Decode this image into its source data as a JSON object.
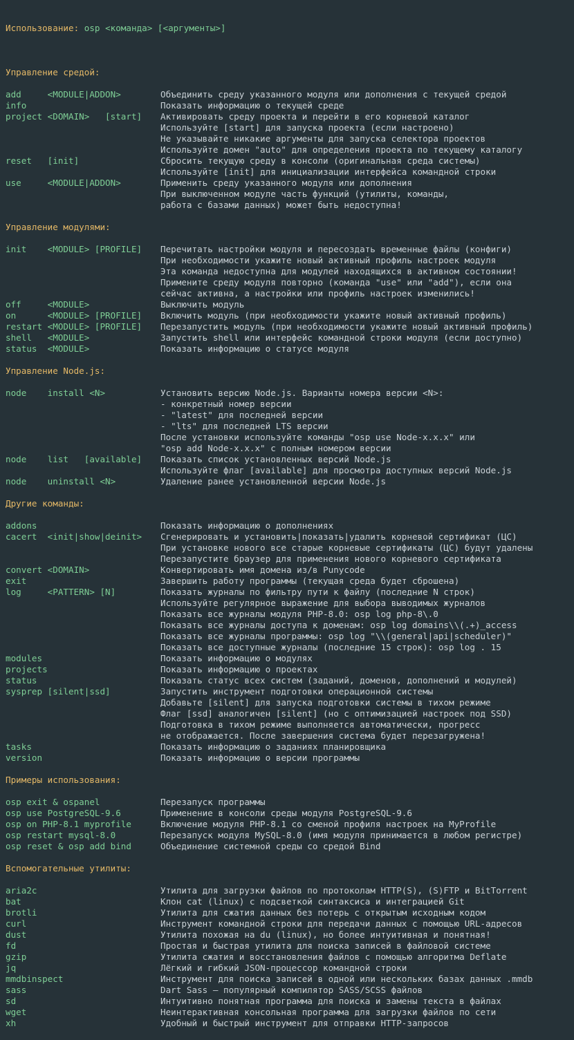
{
  "usage": {
    "label": "Использование:",
    "command": "osp <команда> [<аргументы>]"
  },
  "colors": {
    "background": "#263238",
    "heading": "#e5b967",
    "command": "#7fcf96",
    "text": "#c9d1d6"
  },
  "sections": [
    {
      "title": "Управление средой:",
      "items": [
        {
          "cmd": "add     <MODULE|ADDON>",
          "desc": [
            "Объединить среду указанного модуля или дополнения с текущей средой"
          ]
        },
        {
          "cmd": "info",
          "desc": [
            "Показать информацию о текущей среде"
          ]
        },
        {
          "cmd": "project <DOMAIN>   [start]",
          "desc": [
            "Активировать среду проекта и перейти в его корневой каталог",
            "Используйте [start] для запуска проекта (если настроено)",
            "Не указывайте никакие аргументы для запуска селектора проектов",
            "Используйте домен \"auto\" для определения проекта по текущему каталогу"
          ]
        },
        {
          "cmd": "reset   [init]",
          "desc": [
            "Сбросить текущую среду в консоли (оригинальная среда системы)",
            "Используйте [init] для инициализации интерфейса командной строки"
          ]
        },
        {
          "cmd": "use     <MODULE|ADDON>",
          "desc": [
            "Применить среду указанного модуля или дополнения",
            "При выключенном модуле часть функций (утилиты, команды,",
            "работа с базами данных) может быть недоступна!"
          ]
        }
      ]
    },
    {
      "title": "Управление модулями:",
      "items": [
        {
          "cmd": "init    <MODULE> [PROFILE]",
          "desc": [
            "Перечитать настройки модуля и пересоздать временные файлы (конфиги)",
            "При необходимости укажите новый активный профиль настроек модуля",
            "Эта команда недоступна для модулей находящихся в активном состоянии!",
            "Примените среду модуля повторно (команда \"use\" или \"add\"), если она",
            "сейчас активна, а настройки или профиль настроек изменились!"
          ]
        },
        {
          "cmd": "off     <MODULE>",
          "desc": [
            "Выключить модуль"
          ]
        },
        {
          "cmd": "on      <MODULE> [PROFILE]",
          "desc": [
            "Включить модуль (при необходимости укажите новый активный профиль)"
          ]
        },
        {
          "cmd": "restart <MODULE> [PROFILE]",
          "desc": [
            "Перезапустить модуль (при необходимости укажите новый активный профиль)"
          ]
        },
        {
          "cmd": "shell   <MODULE>",
          "desc": [
            "Запустить shell или интерфейс командной строки модуля (если доступно)"
          ]
        },
        {
          "cmd": "status  <MODULE>",
          "desc": [
            "Показать информацию о статусе модуля"
          ]
        }
      ]
    },
    {
      "title": "Управление Node.js:",
      "items": [
        {
          "cmd": "node    install <N>",
          "desc": [
            "Установить версию Node.js. Варианты номера версии <N>:",
            "- конкретный номер версии",
            "- \"latest\" для последней версии",
            "- \"lts\" для последней LTS версии",
            "После установки используйте команды \"osp use Node-x.x.x\" или",
            "\"osp add Node-x.x.x\" с полным номером версии"
          ]
        },
        {
          "cmd": "node    list   [available]",
          "desc": [
            "Показать список установленных версий Node.js",
            "Используйте флаг [available] для просмотра доступных версий Node.js"
          ]
        },
        {
          "cmd": "node    uninstall <N>",
          "desc": [
            "Удаление ранее установленной версии Node.js"
          ]
        }
      ]
    },
    {
      "title": "Другие команды:",
      "items": [
        {
          "cmd": "addons",
          "desc": [
            "Показать информацию о дополнениях"
          ]
        },
        {
          "cmd": "cacert  <init|show|deinit>",
          "desc": [
            "Сгенерировать и установить|показать|удалить корневой сертификат (ЦС)",
            "При установке нового все старые корневые сертификаты (ЦС) будут удалены",
            "Перезапустите браузер для применения нового корневого сертификата"
          ]
        },
        {
          "cmd": "convert <DOMAIN>",
          "desc": [
            "Конвертировать имя домена из/в Punycode"
          ]
        },
        {
          "cmd": "exit",
          "desc": [
            "Завершить работу программы (текущая среда будет сброшена)"
          ]
        },
        {
          "cmd": "log     <PATTERN> [N]",
          "desc": [
            "Показать журналы по фильтру пути к файлу (последние N строк)",
            "Используйте регулярное выражение для выбора выводимых журналов",
            "Показать все журналы модуля PHP-8.0: osp log php-8\\.0",
            "Показать все журналы доступа к доменам: osp log domains\\\\(.+)_access",
            "Показать все журналы программы: osp log \"\\\\(general|api|scheduler)\"",
            "Показать все доступные журналы (последние 15 строк): osp log . 15"
          ]
        },
        {
          "cmd": "modules",
          "desc": [
            "Показать информацию о модулях"
          ]
        },
        {
          "cmd": "projects",
          "desc": [
            "Показать информацию о проектах"
          ]
        },
        {
          "cmd": "status",
          "desc": [
            "Показать статус всех систем (заданий, доменов, дополнений и модулей)"
          ]
        },
        {
          "cmd": "sysprep [silent|ssd]",
          "desc": [
            "Запустить инструмент подготовки операционной системы",
            "Добавьте [silent] для запуска подготовки системы в тихом режиме",
            "Флаг [ssd] аналогичен [silent] (но с оптимизацией настроек под SSD)",
            "Подготовка в тихом режиме выполняется автоматически, прогресс",
            "не отображается. После завершения система будет перезагружена!"
          ]
        },
        {
          "cmd": "tasks",
          "desc": [
            "Показать информацию о заданиях планировщика"
          ]
        },
        {
          "cmd": "version",
          "desc": [
            "Показать информацию о версии программы"
          ]
        }
      ]
    },
    {
      "title": "Примеры использования:",
      "items": [
        {
          "cmd": "osp exit & ospanel",
          "desc": [
            "Перезапуск программы"
          ]
        },
        {
          "cmd": "osp use PostgreSQL-9.6",
          "desc": [
            "Применение в консоли среды модуля PostgreSQL-9.6"
          ]
        },
        {
          "cmd": "osp on PHP-8.1 myprofile",
          "desc": [
            "Включение модуля PHP-8.1 со сменой профиля настроек на MyProfile"
          ]
        },
        {
          "cmd": "osp restart mysql-8.0",
          "desc": [
            "Перезапуск модуля MySQL-8.0 (имя модуля принимается в любом регистре)"
          ]
        },
        {
          "cmd": "osp reset & osp add bind",
          "desc": [
            "Объединение системной среды со средой Bind"
          ]
        }
      ]
    },
    {
      "title": "Вспомогательные утилиты:",
      "items": [
        {
          "cmd": "aria2c",
          "desc": [
            "Утилита для загрузки файлов по протоколам HTTP(S), (S)FTP и BitTorrent"
          ]
        },
        {
          "cmd": "bat",
          "desc": [
            "Клон cat (linux) с подсветкой синтаксиса и интеграцией Git"
          ]
        },
        {
          "cmd": "brotli",
          "desc": [
            "Утилита для сжатия данных без потерь с открытым исходным кодом"
          ]
        },
        {
          "cmd": "curl",
          "desc": [
            "Инструмент командной строки для передачи данных с помощью URL-адресов"
          ]
        },
        {
          "cmd": "dust",
          "desc": [
            "Утилита похожая на du (linux), но более интуитивная и понятная!"
          ]
        },
        {
          "cmd": "fd",
          "desc": [
            "Простая и быстрая утилита для поиска записей в файловой системе"
          ]
        },
        {
          "cmd": "gzip",
          "desc": [
            "Утилита сжатия и восстановления файлов с помощью алгоритма Deflate"
          ]
        },
        {
          "cmd": "jq",
          "desc": [
            "Лёгкий и гибкий JSON-процессор командной строки"
          ]
        },
        {
          "cmd": "mmdbinspect",
          "desc": [
            "Инструмент для поиска записей в одной или нескольких базах данных .mmdb"
          ]
        },
        {
          "cmd": "sass",
          "desc": [
            "Dart Sass — популярный компилятор SASS/SCSS файлов"
          ]
        },
        {
          "cmd": "sd",
          "desc": [
            "Интуитивно понятная программа для поиска и замены текста в файлах"
          ]
        },
        {
          "cmd": "wget",
          "desc": [
            "Неинтерактивная консольная программа для загрузки файлов по сети"
          ]
        },
        {
          "cmd": "xh",
          "desc": [
            "Удобный и быстрый инструмент для отправки HTTP-запросов"
          ]
        }
      ]
    }
  ]
}
